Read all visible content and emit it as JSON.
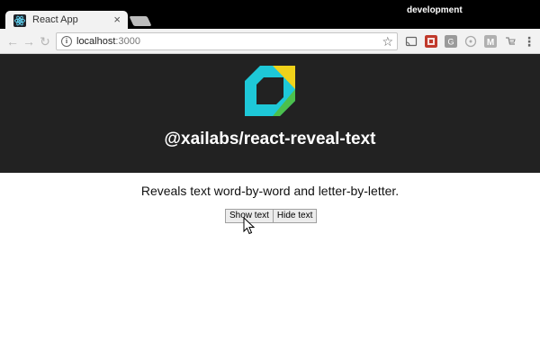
{
  "browser": {
    "tab": {
      "title": "React App",
      "close_glyph": "×",
      "favicon": "react-atom-icon"
    },
    "profile_label": "development",
    "nav": {
      "back": "←",
      "forward": "→",
      "reload": "↻"
    },
    "omnibox": {
      "host": "localhost",
      "port": ":3000",
      "bookmark_glyph": "☆"
    },
    "extensions": [
      "cast-icon",
      "red-extension-icon",
      "gray-g-extension-icon",
      "circle-extension-icon",
      "m-extension-icon",
      "shopping-extension-icon"
    ],
    "menu_glyph": "⋮"
  },
  "page": {
    "header": {
      "title": "@xailabs/react-reveal-text"
    },
    "intro": "Reveals text word-by-word and letter-by-letter.",
    "buttons": {
      "show": "Show text",
      "hide": "Hide text"
    }
  },
  "colors": {
    "header_bg": "#222222",
    "logo_teal": "#1ec8d8",
    "logo_yellow": "#f0d21a",
    "logo_green": "#4cc04c"
  }
}
